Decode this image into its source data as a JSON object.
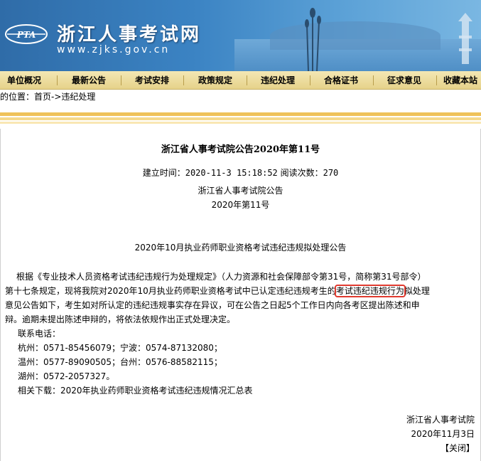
{
  "header": {
    "logo_text": "PTA",
    "site_title": "浙江人事考试网",
    "site_url": "www.zjks.gov.cn"
  },
  "nav": {
    "items": [
      "单位概况",
      "最新公告",
      "考试安排",
      "政策规定",
      "违纪处理",
      "合格证书",
      "征求意见",
      "收藏本站"
    ]
  },
  "breadcrumb": {
    "prefix": "的位置：",
    "home": "首页",
    "separator": "->",
    "current": "违纪处理"
  },
  "article": {
    "title": "浙江省人事考试院公告2020年第11号",
    "created_label": "建立时间：",
    "created_value": "2020-11-3 15:18:52",
    "views_label": "阅读次数：",
    "views_value": "270",
    "org": "浙江省人事考试院公告",
    "number": "2020年第11号",
    "notice_title": "2020年10月执业药师职业资格考试违纪违规拟处理公告",
    "para_lines": [
      "根据《专业技术人员资格考试违纪违规行为处理规定》（人力资源和社会保障部令第31号，简称第31号部令）",
      "第十七条规定，现将我院对2020年10月执业药师职业资格考试中已认定违纪违规考生的",
      "考试违纪违规行为",
      "拟处理",
      "意见公告如下，考生如对所认定的违纪违规事实存在异议，可在公告之日起5个工作日内向各考区提出陈述和申",
      "辩。逾期未提出陈述申辩的，将依法依规作出正式处理决定。"
    ],
    "contact_label": "联系电话：",
    "contacts": [
      "杭州：0571-85456079；宁波：0574-87132080；",
      "温州：0577-89090505；台州：0576-88582115；",
      "湖州：0572-2057327。"
    ],
    "download_label": "相关下载：",
    "download_link": "2020年执业药师职业资格考试违纪违规情况汇总表",
    "signature": "浙江省人事考试院",
    "date": "2020年11月3日",
    "close_label": "【关闭】"
  }
}
